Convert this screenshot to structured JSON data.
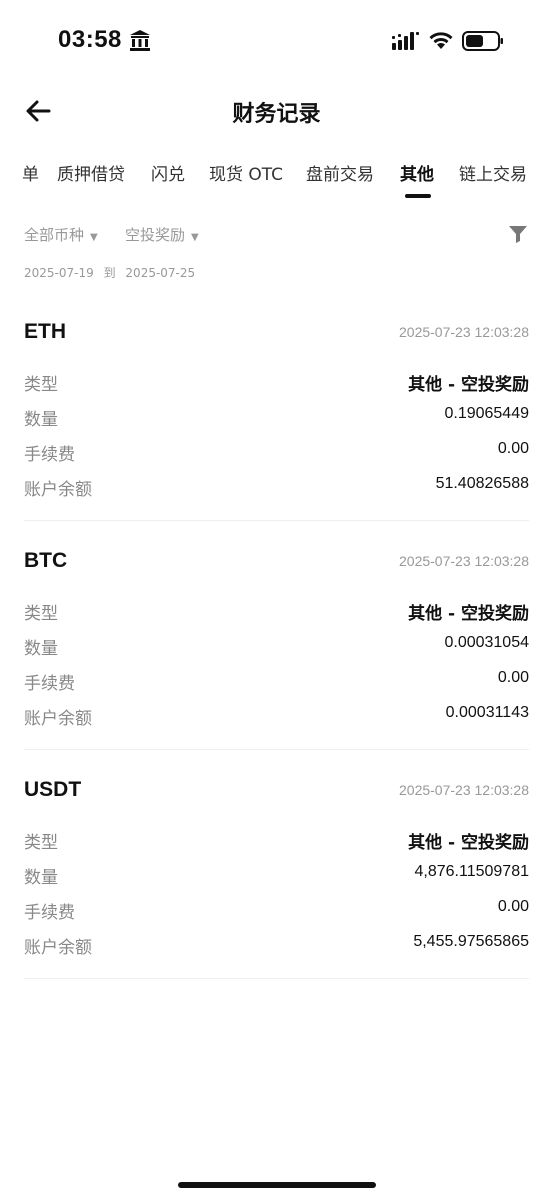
{
  "status_bar": {
    "time": "03:58",
    "icons": [
      "bank-icon",
      "signal-icon",
      "wifi-icon",
      "battery-icon"
    ]
  },
  "header": {
    "title": "财务记录",
    "back_icon": "back-arrow-icon"
  },
  "tabs": [
    {
      "label": "单",
      "active": false
    },
    {
      "label": "质押借贷",
      "active": false
    },
    {
      "label": "闪兑",
      "active": false
    },
    {
      "label": "现货 OTC",
      "active": false
    },
    {
      "label": "盘前交易",
      "active": false
    },
    {
      "label": "其他",
      "active": true
    },
    {
      "label": "链上交易",
      "active": false
    }
  ],
  "filters": {
    "currency": "全部币种",
    "type": "空投奖励",
    "filter_icon": "funnel-icon"
  },
  "date_range": {
    "start": "2025-07-19",
    "sep": "到",
    "end": "2025-07-25"
  },
  "labels": {
    "type": "类型",
    "amount": "数量",
    "fee": "手续费",
    "balance": "账户余额"
  },
  "records": [
    {
      "coin": "ETH",
      "time": "2025-07-23 12:03:28",
      "type": "其他 - 空投奖励",
      "amount": "0.19065449",
      "fee": "0.00",
      "balance": "51.40826588"
    },
    {
      "coin": "BTC",
      "time": "2025-07-23 12:03:28",
      "type": "其他 - 空投奖励",
      "amount": "0.00031054",
      "fee": "0.00",
      "balance": "0.00031143"
    },
    {
      "coin": "USDT",
      "time": "2025-07-23 12:03:28",
      "type": "其他 - 空投奖励",
      "amount": "4,876.11509781",
      "fee": "0.00",
      "balance": "5,455.97565865"
    }
  ],
  "colors": {
    "text_primary": "#111111",
    "text_secondary": "#888888",
    "text_muted": "#999999",
    "divider": "#eeeeee"
  }
}
